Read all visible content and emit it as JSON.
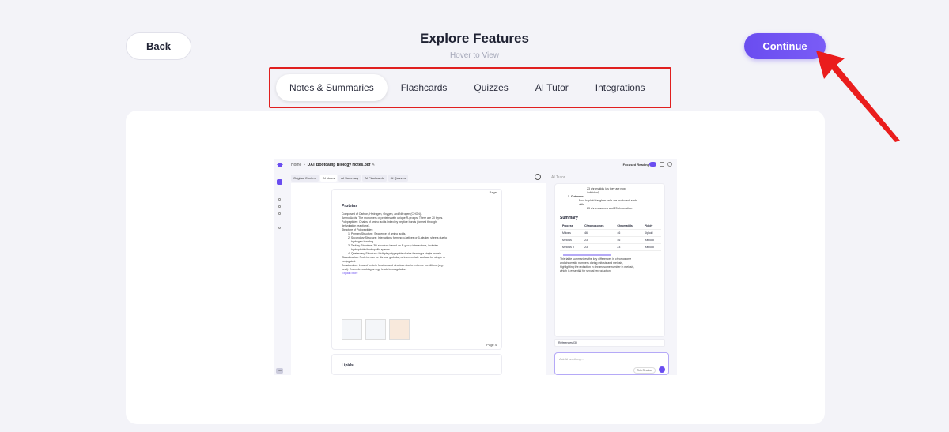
{
  "header": {
    "title": "Explore Features",
    "subtitle": "Hover to View",
    "back_label": "Back",
    "continue_label": "Continue"
  },
  "tabs": [
    {
      "label": "Notes & Summaries",
      "active": true
    },
    {
      "label": "Flashcards",
      "active": false
    },
    {
      "label": "Quizzes",
      "active": false
    },
    {
      "label": "AI Tutor",
      "active": false
    },
    {
      "label": "Integrations",
      "active": false
    }
  ],
  "colors": {
    "accent": "#6a4df0",
    "highlight_frame": "#e01f1f",
    "arrow": "#ea1d1d",
    "background": "#f3f3f8"
  },
  "preview": {
    "breadcrumb_home": "Home",
    "breadcrumb_file": "DAT Bootcamp Biology Notes.pdf",
    "focused_reading": "Focused Reading",
    "subtabs": [
      "Original Content",
      "AI Notes",
      "AI Summary",
      "AI Flashcards",
      "AI Quizzes"
    ],
    "ai_tutor_label": "AI Tutor",
    "avatar": "DA",
    "card_title": "Proteins",
    "page_top": "Page",
    "page_bottom": "Page",
    "page_bottom_num": "4",
    "lines": [
      "Composed of Carbon, Hydrogen, Oxygen, and Nitrogen (CHON).",
      "Amino Acids: The monomers of proteins with unique R-groups. There are 20 types.",
      "Polypeptides: Chains of amino acids linked by peptide bonds (formed through",
      "dehydration reactions).",
      "Structure of Polypeptides:",
      "1. Primary Structure: Sequence of amino acids.",
      "2. Secondary Structure: Interactions forming α-helices or β-pleated sheets due to",
      "hydrogen bonding.",
      "3. Tertiary Structure: 3D structure based on R-group interactions, includes",
      "hydrophobic/hydrophilic spaces.",
      "4. Quaternary Structure: Multiple polypeptide chains forming a single protein.",
      "Classification: Proteins can be fibrous, globular, or intermediate and can be simple or",
      "conjugated.",
      "Denaturation: Loss of protein function and structure due to extreme conditions (e.g.,",
      "heat). Example: cooking an egg leads to coagulation.",
      "Explain More"
    ],
    "card2_title": "Lipids",
    "side_lines_top": [
      "23 chromatids (as they are now",
      "individual).",
      "3. Outcome:",
      "Four haploid daughter cells are produced, each",
      "with:",
      "23 chromosomes and 23 chromatids."
    ],
    "summary_title": "Summary",
    "table": {
      "headers": [
        "Process",
        "Chromosomes",
        "Chromatids",
        "Ploidy"
      ],
      "rows": [
        [
          "Mitosis",
          "46",
          "46",
          "Diploid"
        ],
        [
          "Meiosis I",
          "23",
          "46",
          "Haploid"
        ],
        [
          "Meiosis II",
          "23",
          "23",
          "Haploid"
        ]
      ]
    },
    "side_lines_bottom": [
      "This table summarizes the key differences in chromosome",
      "and chromatid numbers during mitosis and meiosis,",
      "highlighting the reduction in chromosome number in meiosis,",
      "which is essential for sexual reproduction."
    ],
    "references": "References (3)",
    "ask_placeholder": "Ask AI anything...",
    "this_session": "This Session"
  }
}
